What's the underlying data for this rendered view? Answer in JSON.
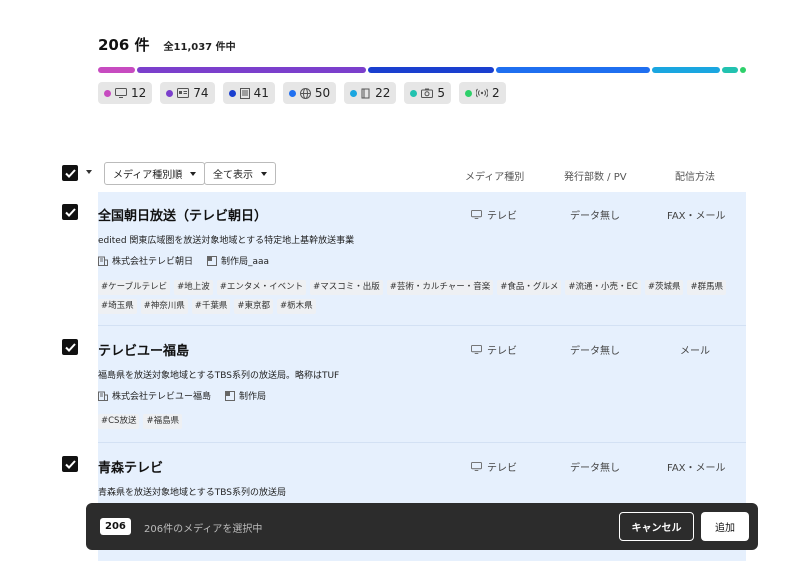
{
  "summary": {
    "count": "206 件",
    "total": "全11,037 件中"
  },
  "distribution": [
    {
      "name": "tv",
      "color": "#c74bc0",
      "weight": 12
    },
    {
      "name": "radio-card",
      "color": "#7b3fcc",
      "weight": 74
    },
    {
      "name": "newspaper",
      "color": "#1a3fcf",
      "weight": 41
    },
    {
      "name": "web",
      "color": "#1f6ff0",
      "weight": 50
    },
    {
      "name": "magazine",
      "color": "#1aa6e0",
      "weight": 22
    },
    {
      "name": "photo",
      "color": "#22c2b0",
      "weight": 5
    },
    {
      "name": "broadcast",
      "color": "#2ed06a",
      "weight": 2
    }
  ],
  "chips": [
    {
      "icon": "tv-icon",
      "color": "#c74bc0",
      "count": "12"
    },
    {
      "icon": "id-card-icon",
      "color": "#7b3fcc",
      "count": "74"
    },
    {
      "icon": "newspaper-icon",
      "color": "#1a3fcf",
      "count": "41"
    },
    {
      "icon": "globe-icon",
      "color": "#1f6ff0",
      "count": "50"
    },
    {
      "icon": "book-icon",
      "color": "#1aa6e0",
      "count": "22"
    },
    {
      "icon": "camera-icon",
      "color": "#22c2b0",
      "count": "5"
    },
    {
      "icon": "radio-wave-icon",
      "color": "#2ed06a",
      "count": "2"
    }
  ],
  "toolbar": {
    "sort_label": "メディア種別順",
    "filter_label": "全て表示",
    "col_media": "メディア種別",
    "col_dept": "発行部数 / PV",
    "col_delivery": "配信方法"
  },
  "rows": [
    {
      "title": "全国朝日放送（テレビ朝日）",
      "media": "テレビ",
      "dept": "データ無し",
      "delivery": "FAX・メール",
      "desc": "edited 関東広域圏を放送対象地域とする特定地上基幹放送事業",
      "company": "株式会社テレビ朝日",
      "bureau": "制作局_aaa",
      "tags": [
        "#ケーブルテレビ",
        "#地上波",
        "#エンタメ・イベント",
        "#マスコミ・出版",
        "#芸術・カルチャー・音楽",
        "#食品・グルメ",
        "#流通・小売・EC",
        "#茨城県",
        "#群馬県",
        "#埼玉県",
        "#神奈川県",
        "#千葉県",
        "#東京都",
        "#栃木県"
      ]
    },
    {
      "title": "テレビユー福島",
      "media": "テレビ",
      "dept": "データ無し",
      "delivery": "メール",
      "desc": "福島県を放送対象地域とするTBS系列の放送局。略称はTUF",
      "company": "株式会社テレビユー福島",
      "bureau": "制作局",
      "tags": [
        "#CS放送",
        "#福島県"
      ]
    },
    {
      "title": "青森テレビ",
      "media": "テレビ",
      "dept": "データ無し",
      "delivery": "FAX・メール",
      "desc": "青森県を放送対象地域とするTBS系列の放送局",
      "company": "",
      "bureau": "",
      "tags": []
    }
  ],
  "footer": {
    "count": "206",
    "text": "206件のメディアを選択中",
    "cancel": "キャンセル",
    "add": "追加"
  }
}
